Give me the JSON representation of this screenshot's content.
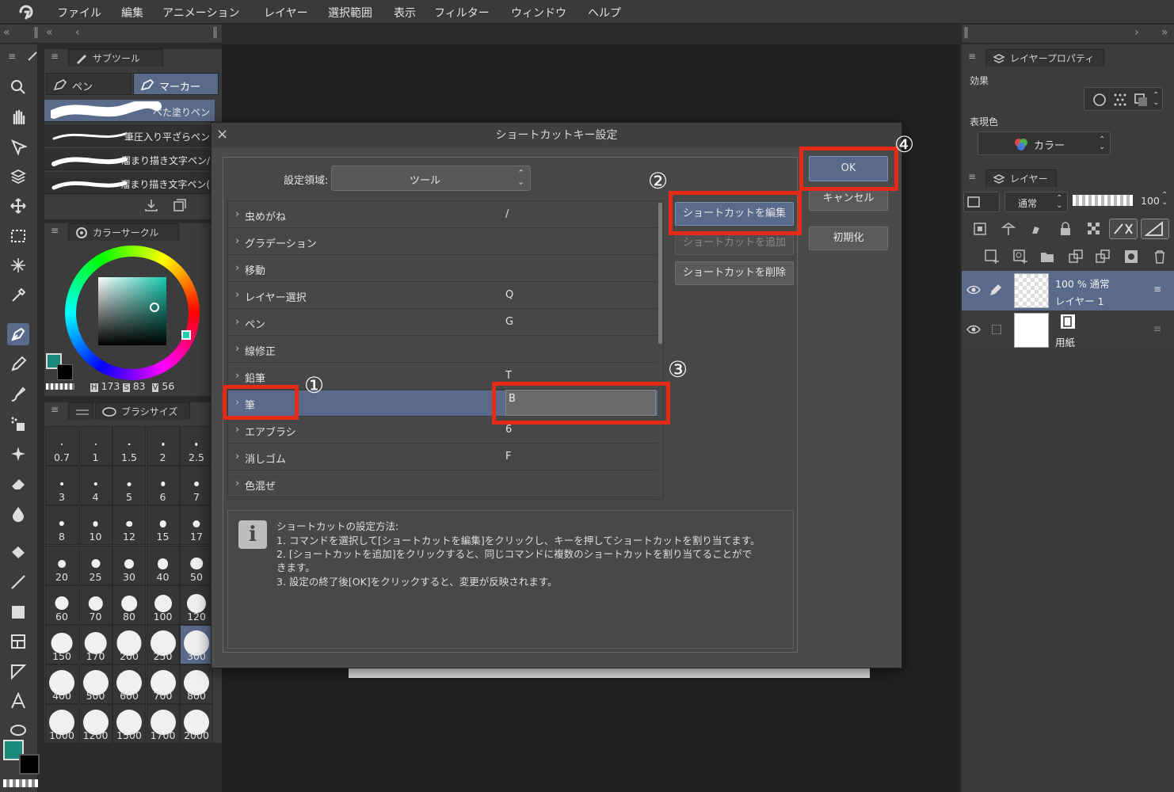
{
  "menu": [
    "ファイル",
    "編集",
    "アニメーション",
    "レイヤー",
    "選択範囲",
    "表示",
    "フィルター",
    "ウィンドウ",
    "ヘルプ"
  ],
  "subtool_panel": {
    "title": "サブツール",
    "tabs": [
      "ペン",
      "マーカー"
    ],
    "brushes": [
      "べた塗りペン",
      "筆圧入り平ざらペン",
      "溜まり描き文字ペン/",
      "溜まり描き文字ペン("
    ]
  },
  "color_panel": {
    "title": "カラーサークル",
    "h_label": "H",
    "h_value": "173",
    "s_label": "S",
    "s_value": "83",
    "v_label": "V",
    "v_value": "56",
    "main_color": "#1b8a7a"
  },
  "brushsize_panel": {
    "title": "ブラシサイズ",
    "sizes": [
      "0.7",
      "1",
      "1.5",
      "2",
      "2.5",
      "3",
      "4",
      "5",
      "6",
      "7",
      "8",
      "10",
      "12",
      "15",
      "17",
      "20",
      "25",
      "30",
      "40",
      "50",
      "60",
      "70",
      "80",
      "100",
      "120",
      "150",
      "170",
      "200",
      "250",
      "300",
      "400",
      "500",
      "600",
      "700",
      "800",
      "1000",
      "1200",
      "1500",
      "1700",
      "2000"
    ],
    "selected": "300"
  },
  "layer_property": {
    "title": "レイヤープロパティ",
    "effect_label": "効果",
    "expression_label": "表現色",
    "expression_value": "カラー"
  },
  "layer_panel": {
    "title": "レイヤー",
    "blend": "通常",
    "opacity": "100",
    "layers": [
      {
        "info": "100 % 通常",
        "name": "レイヤー 1"
      },
      {
        "info": "",
        "name": "用紙"
      }
    ]
  },
  "dialog": {
    "title": "ショートカットキー設定",
    "area_label": "設定領域:",
    "area_value": "ツール",
    "rows": [
      {
        "name": "虫めがね",
        "key": "/"
      },
      {
        "name": "グラデーション",
        "key": ""
      },
      {
        "name": "移動",
        "key": ""
      },
      {
        "name": "レイヤー選択",
        "key": "Q"
      },
      {
        "name": "ペン",
        "key": "G"
      },
      {
        "name": "線修正",
        "key": ""
      },
      {
        "name": "鉛筆",
        "key": "T"
      },
      {
        "name": "筆",
        "key": "B"
      },
      {
        "name": "エアブラシ",
        "key": "6"
      },
      {
        "name": "消しゴム",
        "key": "F"
      },
      {
        "name": "色混ぜ",
        "key": ""
      }
    ],
    "edit_button": "ショートカットを編集",
    "add_button": "ショートカットを追加",
    "delete_button": "ショートカットを削除",
    "ok_button": "OK",
    "cancel_button": "キャンセル",
    "reset_button": "初期化",
    "info_title": "ショートカットの設定方法:",
    "info_lines": [
      "1. コマンドを選択して[ショートカットを編集]をクリックし、キーを押してショートカットを割り当てます。",
      "2. [ショートカットを追加]をクリックすると、同じコマンドに複数のショートカットを割り当てることがで",
      "きます。",
      "3. 設定の終了後[OK]をクリックすると、変更が反映されます。"
    ]
  },
  "annotations": {
    "n1": "①",
    "n2": "②",
    "n3": "③",
    "n4": "④"
  },
  "colors": {
    "highlight": "#e52a17",
    "selection": "#5a6a8a"
  }
}
